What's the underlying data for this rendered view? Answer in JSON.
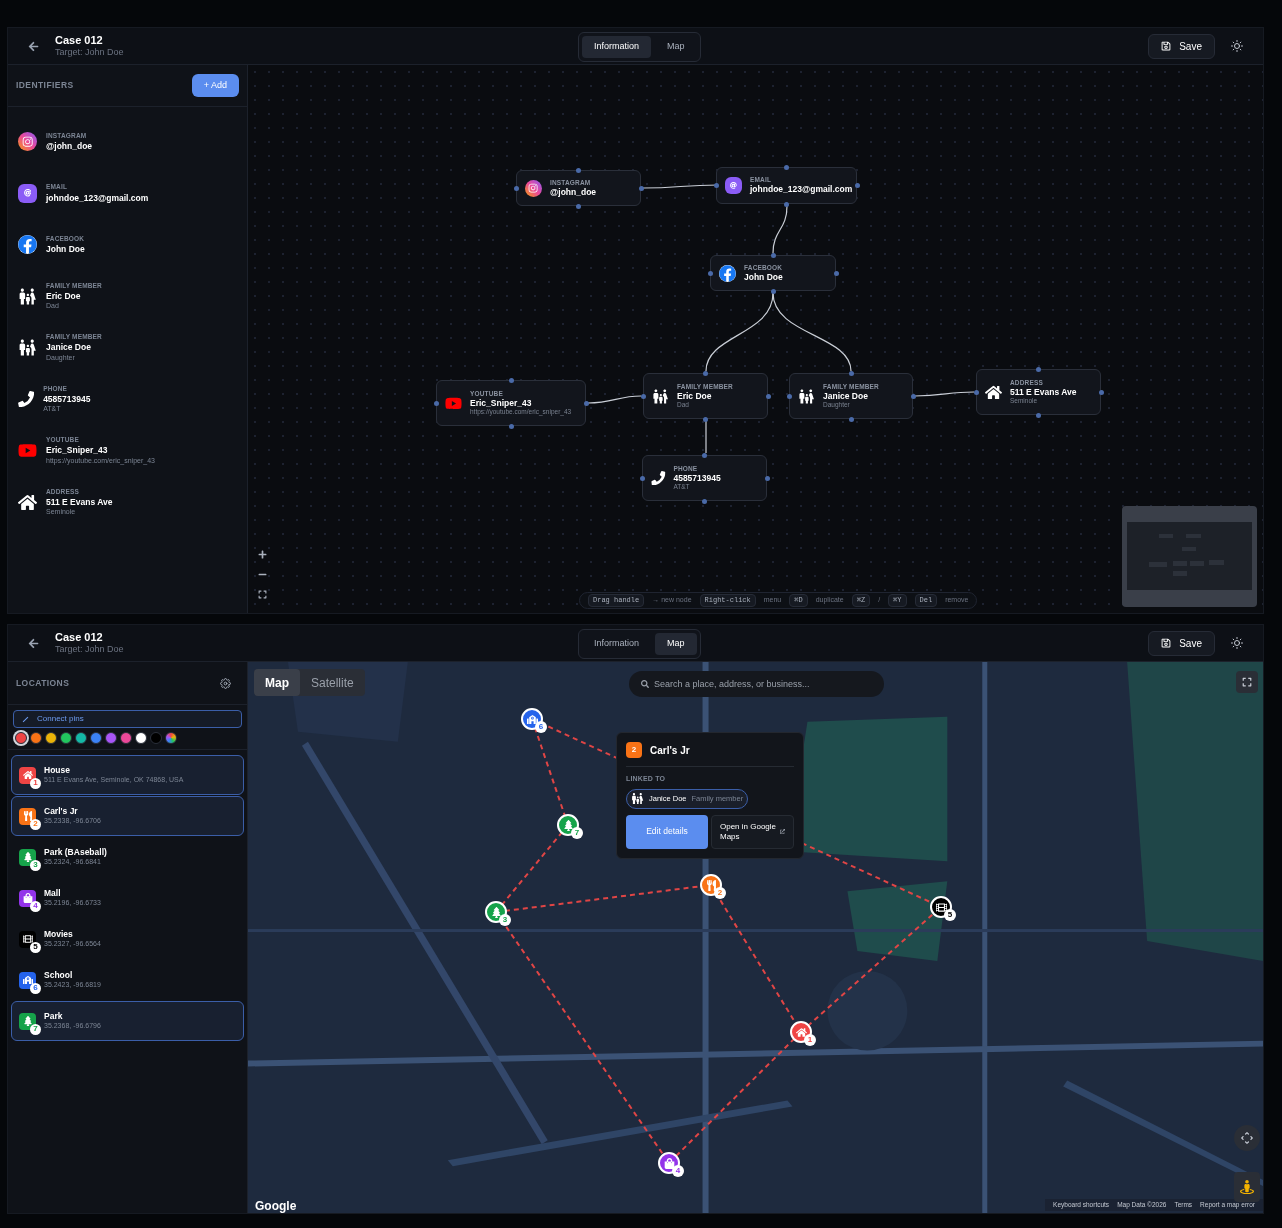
{
  "graph_view": {
    "header": {
      "title": "Case 012",
      "subtitle": "Target: John Doe",
      "tabs": [
        {
          "label": "Information",
          "selected": true
        },
        {
          "label": "Map",
          "selected": false
        }
      ],
      "save": "Save"
    },
    "sidebar": {
      "heading": "IDENTIFIERS",
      "add": "+ Add",
      "items": [
        {
          "kind": "instagram",
          "label": "INSTAGRAM",
          "value": "@john_doe"
        },
        {
          "kind": "email",
          "label": "EMAIL",
          "value": "johndoe_123@gmail.com"
        },
        {
          "kind": "facebook",
          "label": "FACEBOOK",
          "value": "John Doe"
        },
        {
          "kind": "family",
          "label": "FAMILY MEMBER",
          "value": "Eric Doe",
          "detail": "Dad"
        },
        {
          "kind": "family",
          "label": "FAMILY MEMBER",
          "value": "Janice Doe",
          "detail": "Daughter"
        },
        {
          "kind": "phone",
          "label": "PHONE",
          "value": "4585713945",
          "detail": "AT&T"
        },
        {
          "kind": "youtube",
          "label": "YOUTUBE",
          "value": "Eric_Sniper_43",
          "detail": "https://youtube.com/eric_sniper_43"
        },
        {
          "kind": "address",
          "label": "ADDRESS",
          "value": "511 E Evans Ave",
          "detail": "Seminole"
        }
      ]
    },
    "nodes": [
      {
        "kind": "instagram",
        "label": "INSTAGRAM",
        "value": "@john_doe"
      },
      {
        "kind": "email",
        "label": "EMAIL",
        "value": "johndoe_123@gmail.com"
      },
      {
        "kind": "facebook",
        "label": "FACEBOOK",
        "value": "John Doe"
      },
      {
        "kind": "youtube",
        "label": "YOUTUBE",
        "value": "Eric_Sniper_43",
        "detail": "https://youtube.com/eric_sniper_43"
      },
      {
        "kind": "family",
        "label": "FAMILY MEMBER",
        "value": "Eric Doe",
        "detail": "Dad"
      },
      {
        "kind": "family",
        "label": "FAMILY MEMBER",
        "value": "Janice Doe",
        "detail": "Daughter"
      },
      {
        "kind": "address",
        "label": "ADDRESS",
        "value": "511 E Evans Ave",
        "detail": "Seminole"
      },
      {
        "kind": "phone",
        "label": "PHONE",
        "value": "4585713945",
        "detail": "AT&T"
      }
    ],
    "hints": [
      {
        "key": "Drag handle",
        "text": "→ new node"
      },
      {
        "key": "Right-click",
        "text": "menu"
      },
      {
        "key": "⌘D",
        "text": "duplicate"
      },
      {
        "key": "⌘Z",
        "sep": "/",
        "key2": "⌘Y"
      },
      {
        "key": "Del",
        "text": "remove"
      }
    ]
  },
  "map_view": {
    "header": {
      "title": "Case 012",
      "subtitle": "Target: John Doe",
      "tabs": [
        {
          "label": "Information",
          "selected": false
        },
        {
          "label": "Map",
          "selected": true
        }
      ],
      "save": "Save"
    },
    "sidebar": {
      "heading": "LOCATIONS",
      "connect": "Connect pins",
      "swatches": [
        {
          "color": "#ef4444",
          "selected": true
        },
        {
          "color": "#f97316",
          "selected": false
        },
        {
          "color": "#eab308",
          "selected": false
        },
        {
          "color": "#22c55e",
          "selected": false
        },
        {
          "color": "#14b8a6",
          "selected": false
        },
        {
          "color": "#3b82f6",
          "selected": false
        },
        {
          "color": "#a855f7",
          "selected": false
        },
        {
          "color": "#ec4899",
          "selected": false
        },
        {
          "color": "#ffffff",
          "selected": false
        },
        {
          "color": "#000000",
          "selected": false
        },
        {
          "kind": "rainbow",
          "selected": false
        }
      ],
      "items": [
        {
          "kind": "house",
          "name": "House",
          "detail": "511 E Evans Ave, Seminole, OK 74868, USA",
          "badge": "1",
          "color": "#ef4444",
          "selected": true
        },
        {
          "kind": "food",
          "name": "Carl's Jr",
          "detail": "35.2338, -96.6706",
          "badge": "2",
          "color": "#f97316",
          "selected": true
        },
        {
          "kind": "park",
          "name": "Park (BAseball)",
          "detail": "35.2324, -96.6841",
          "badge": "3",
          "color": "#16a34a",
          "selected": false
        },
        {
          "kind": "mall",
          "name": "Mall",
          "detail": "35.2196, -96.6733",
          "badge": "4",
          "color": "#9333ea",
          "selected": false
        },
        {
          "kind": "movies",
          "name": "Movies",
          "detail": "35.2327, -96.6564",
          "badge": "5",
          "color": "#000000",
          "selected": false
        },
        {
          "kind": "school",
          "name": "School",
          "detail": "35.2423, -96.6819",
          "badge": "6",
          "color": "#2563eb",
          "selected": false
        },
        {
          "kind": "park",
          "name": "Park",
          "detail": "35.2368, -96.6796",
          "badge": "7",
          "color": "#16a34a",
          "selected": true
        }
      ]
    },
    "map": {
      "types": [
        {
          "label": "Map",
          "selected": true
        },
        {
          "label": "Satellite",
          "selected": false
        }
      ],
      "search": {
        "placeholder": "Search a place, address, or business..."
      },
      "pins": [
        {
          "kind": "house",
          "badge": "1",
          "color": "#ef4444"
        },
        {
          "kind": "food",
          "badge": "2",
          "color": "#f97316"
        },
        {
          "kind": "park",
          "badge": "3",
          "color": "#16a34a"
        },
        {
          "kind": "mall",
          "badge": "4",
          "color": "#9333ea"
        },
        {
          "kind": "movies",
          "badge": "5",
          "color": "#000000"
        },
        {
          "kind": "school",
          "badge": "6",
          "color": "#2563eb"
        },
        {
          "kind": "park",
          "badge": "7",
          "color": "#16a34a"
        }
      ],
      "popup": {
        "badge": "2",
        "title": "Carl's Jr",
        "linked_heading": "LINKED TO",
        "linked": {
          "name": "Janice Doe",
          "type": "Family member"
        },
        "edit": "Edit details",
        "open": "Open in Google Maps"
      },
      "logo": "Google",
      "attribution": [
        "Keyboard shortcuts",
        "Map Data ©2026",
        "Terms",
        "Report a map error"
      ]
    }
  }
}
